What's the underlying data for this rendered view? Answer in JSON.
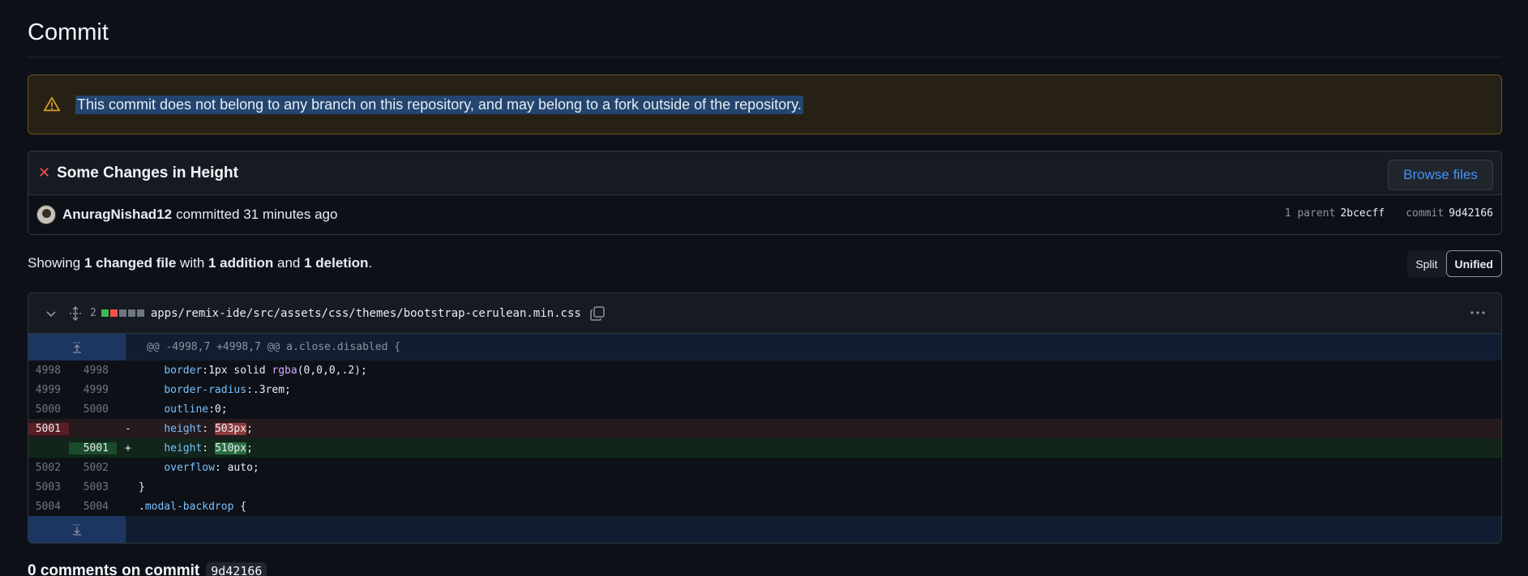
{
  "page": {
    "title": "Commit"
  },
  "flash": {
    "message": "This commit does not belong to any branch on this repository, and may belong to a fork outside of the repository."
  },
  "commit": {
    "title": "Some Changes in Height",
    "browse_label": "Browse files",
    "author": "AnuragNishad12",
    "committed_text": "committed 31 minutes ago",
    "parent_label": "1 parent",
    "parent_sha": "2bcecff",
    "commit_label": "commit",
    "commit_sha": "9d42166"
  },
  "summary": {
    "prefix": "Showing ",
    "files": "1 changed file",
    "mid1": " with ",
    "additions": "1 addition",
    "mid2": " and ",
    "deletions": "1 deletion",
    "suffix": "."
  },
  "view_toggle": {
    "split": "Split",
    "unified": "Unified"
  },
  "file": {
    "change_count": "2",
    "path": "apps/remix-ide/src/assets/css/themes/bootstrap-cerulean.min.css",
    "hunk_header": "@@ -4998,7 +4998,7 @@ a.close.disabled {"
  },
  "diff_rows": [
    {
      "old": "4998",
      "new": "4998",
      "sign": "",
      "type": "ctx",
      "pre": "    ",
      "prop": "border",
      "rest": ":1px solid ",
      "fn": "rgba",
      "tail": "(0,0,0,.2);"
    },
    {
      "old": "4999",
      "new": "4999",
      "sign": "",
      "type": "ctx",
      "pre": "    ",
      "prop": "border-radius",
      "rest": ":.3rem;",
      "fn": "",
      "tail": ""
    },
    {
      "old": "5000",
      "new": "5000",
      "sign": "",
      "type": "ctx",
      "pre": "    ",
      "prop": "outline",
      "rest": ":0;",
      "fn": "",
      "tail": ""
    },
    {
      "old": "5001",
      "new": "",
      "sign": "-",
      "type": "del",
      "pre": "    ",
      "prop": "height",
      "rest": ": ",
      "hl": "503px",
      "tail": ";"
    },
    {
      "old": "",
      "new": "5001",
      "sign": "+",
      "type": "add",
      "pre": "    ",
      "prop": "height",
      "rest": ": ",
      "hl": "510px",
      "tail": ";"
    },
    {
      "old": "5002",
      "new": "5002",
      "sign": "",
      "type": "ctx",
      "pre": "    ",
      "prop": "overflow",
      "rest": ": auto;",
      "fn": "",
      "tail": ""
    },
    {
      "old": "5003",
      "new": "5003",
      "sign": "",
      "type": "ctx",
      "pre": "",
      "prop": "",
      "rest": "}",
      "fn": "",
      "tail": ""
    },
    {
      "old": "5004",
      "new": "5004",
      "sign": "",
      "type": "ctx",
      "pre": "",
      "prop": "",
      "rest": ".",
      "sel": "modal-backdrop",
      "tail": " {"
    }
  ],
  "comments": {
    "title": "0 comments on commit",
    "sha": "9d42166"
  },
  "colors": {
    "accent": "#4493f8",
    "danger": "#f85149",
    "success": "#3fb950",
    "warning": "#d29922"
  }
}
